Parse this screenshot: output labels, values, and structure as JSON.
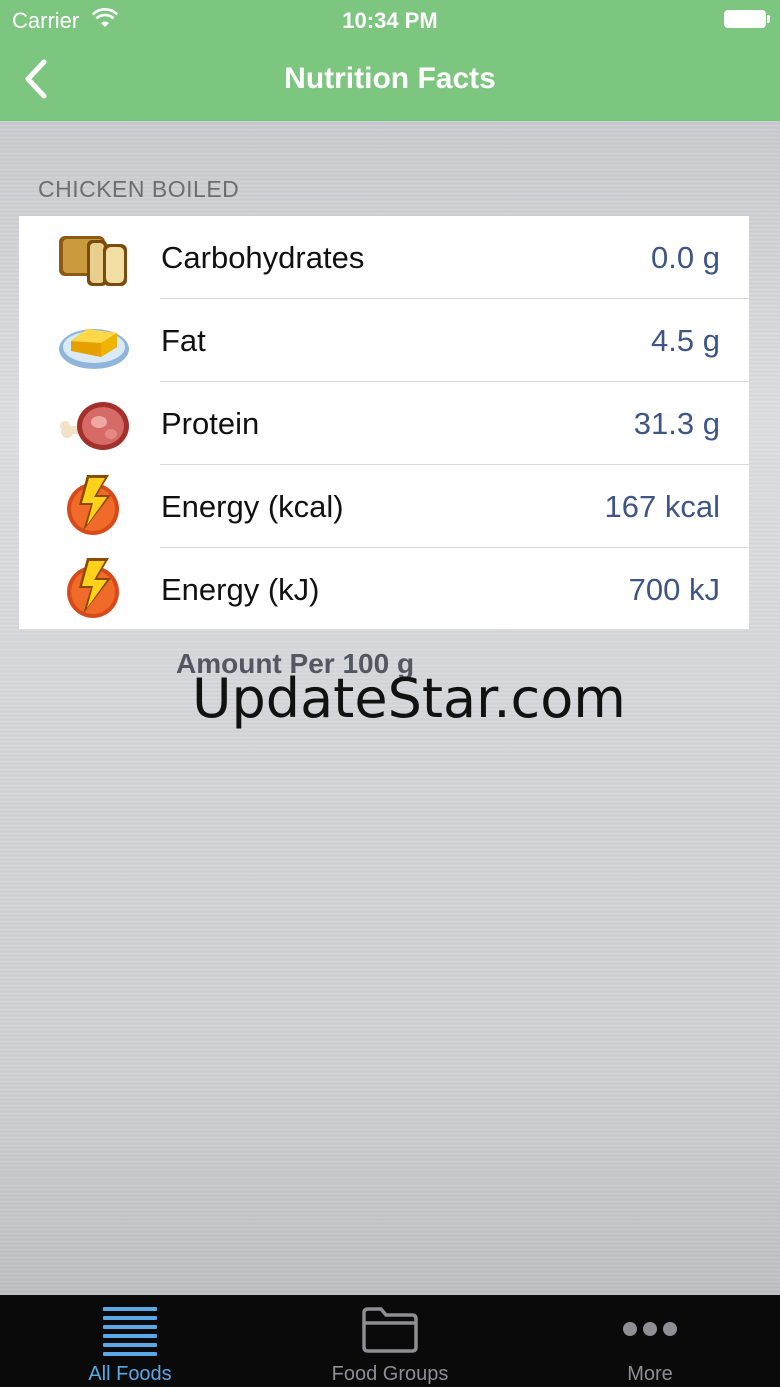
{
  "status_bar": {
    "carrier": "Carrier",
    "time": "10:34 PM"
  },
  "nav": {
    "title": "Nutrition Facts",
    "back_icon": "chevron-left-icon"
  },
  "section": {
    "title": "CHICKEN BOILED"
  },
  "nutrients": [
    {
      "label": "Carbohydrates",
      "value": "0.0 g",
      "icon": "bread-icon"
    },
    {
      "label": "Fat",
      "value": "4.5 g",
      "icon": "butter-icon"
    },
    {
      "label": "Protein",
      "value": "31.3 g",
      "icon": "meat-icon"
    },
    {
      "label": "Energy (kcal)",
      "value": "167 kcal",
      "icon": "lightning-icon"
    },
    {
      "label": "Energy (kJ)",
      "value": "700 kJ",
      "icon": "lightning-icon"
    }
  ],
  "footer": {
    "amount": "Amount Per 100 g",
    "watermark": "UpdateStar.com"
  },
  "tabs": [
    {
      "label": "All Foods",
      "icon": "list-icon",
      "active": true
    },
    {
      "label": "Food Groups",
      "icon": "folder-icon",
      "active": false
    },
    {
      "label": "More",
      "icon": "more-icon",
      "active": false
    }
  ],
  "colors": {
    "nav_green": "#7dc67f",
    "value_blue": "#3f5588",
    "tab_active": "#5aa9e6"
  }
}
